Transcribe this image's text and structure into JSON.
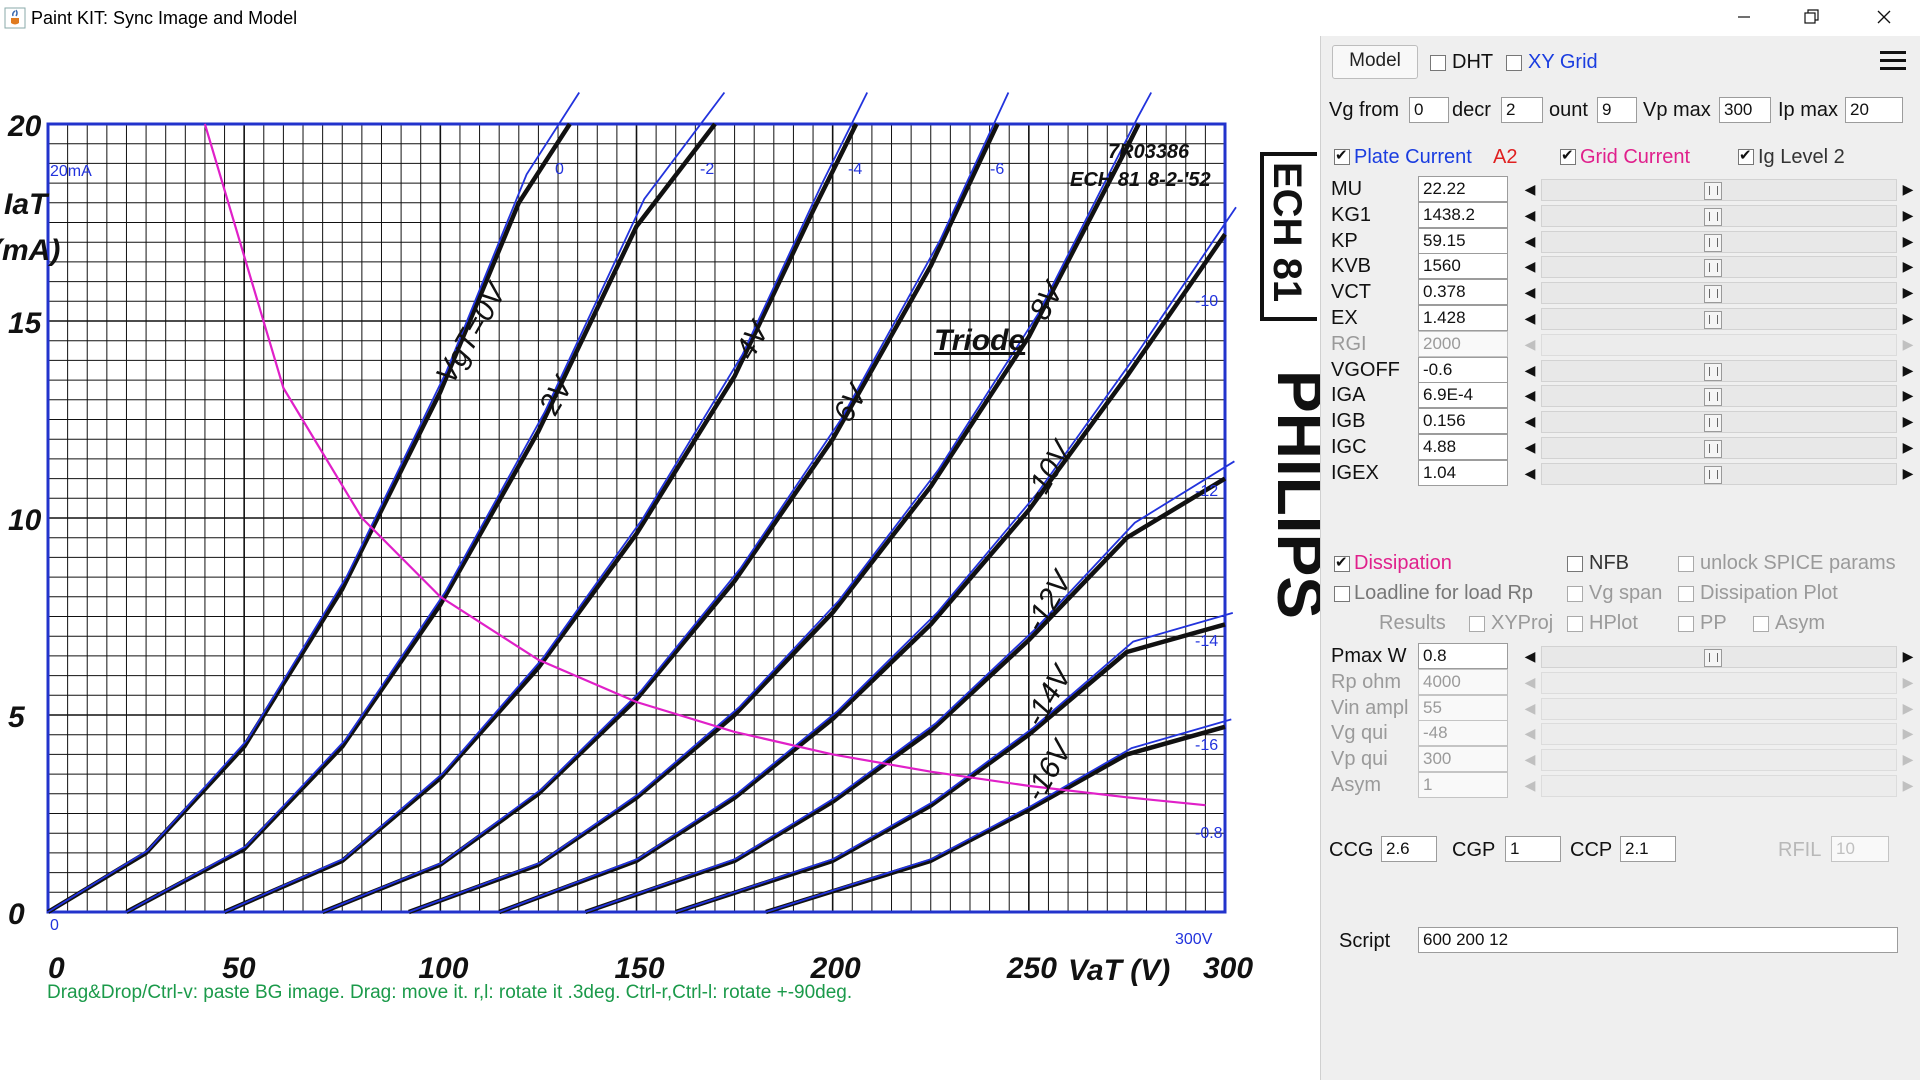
{
  "window": {
    "title": "Paint KIT: Sync Image and Model",
    "minimize_label": "minimize",
    "restore_label": "restore",
    "close_label": "close"
  },
  "canvas": {
    "hint": "Drag&Drop/Ctrl-v: paste BG image. Drag: move it. r,l: rotate it .3deg. Ctrl-r,Ctrl-l: rotate +-90deg.",
    "bg_image": {
      "ref": "7R03386",
      "tube": "ECH 81",
      "date": "8-2-'52",
      "mode": "Triode",
      "brand_box": "ECH 81",
      "brand": "PHILIPS",
      "y_label": "IaT",
      "y_unit": "(mA)",
      "x_label": "VaT (V)",
      "corner_top": "20mA",
      "corner_bottom": "300V",
      "corner_zero": "0"
    }
  },
  "chart_data": {
    "type": "line",
    "title": "",
    "xlabel": "VaT (V)",
    "ylabel": "IaT (mA)",
    "xlim": [
      0,
      300
    ],
    "ylim": [
      0,
      20
    ],
    "x_ticks": [
      "0",
      "50",
      "100",
      "150",
      "200",
      "250",
      "300"
    ],
    "y_ticks": [
      "0",
      "5",
      "10",
      "15",
      "20"
    ],
    "grid": true,
    "model_grid_labels_top": [
      "0",
      "-2",
      "-4",
      "-6"
    ],
    "model_grid_labels_right": [
      "-10",
      "-12",
      "-14",
      "-16",
      "-0.8"
    ],
    "series": [
      {
        "name": "VgT=0V",
        "vg": 0,
        "x": [
          0,
          25,
          50,
          75,
          100,
          120,
          133
        ],
        "y": [
          0,
          1.5,
          4.2,
          8.2,
          13.2,
          18.0,
          20
        ]
      },
      {
        "name": "-2V",
        "vg": -2,
        "x": [
          20,
          50,
          75,
          100,
          125,
          150,
          170
        ],
        "y": [
          0,
          1.6,
          4.2,
          7.8,
          12.2,
          17.4,
          20
        ]
      },
      {
        "name": "-4V",
        "vg": -4,
        "x": [
          45,
          75,
          100,
          125,
          150,
          175,
          195,
          206
        ],
        "y": [
          0,
          1.3,
          3.4,
          6.2,
          9.6,
          13.6,
          17.8,
          20
        ]
      },
      {
        "name": "-6V",
        "vg": -6,
        "x": [
          70,
          100,
          125,
          150,
          175,
          200,
          225,
          242
        ],
        "y": [
          0,
          1.2,
          3.0,
          5.4,
          8.4,
          12.0,
          16.4,
          20
        ]
      },
      {
        "name": "-8V",
        "vg": -8,
        "x": [
          92,
          125,
          150,
          175,
          200,
          225,
          250,
          275,
          278
        ],
        "y": [
          0,
          1.2,
          2.9,
          5.0,
          7.6,
          10.8,
          14.6,
          19.4,
          20
        ]
      },
      {
        "name": "-10V",
        "vg": -10,
        "x": [
          115,
          150,
          175,
          200,
          225,
          250,
          275,
          300
        ],
        "y": [
          0,
          1.3,
          2.9,
          4.9,
          7.3,
          10.2,
          13.6,
          17.2
        ]
      },
      {
        "name": "-12V",
        "vg": -12,
        "x": [
          137,
          175,
          200,
          225,
          250,
          275,
          300
        ],
        "y": [
          0,
          1.3,
          2.8,
          4.6,
          6.9,
          9.5,
          11.0
        ]
      },
      {
        "name": "-14V",
        "vg": -14,
        "x": [
          160,
          200,
          225,
          250,
          275,
          300
        ],
        "y": [
          0,
          1.3,
          2.7,
          4.5,
          6.6,
          7.3
        ]
      },
      {
        "name": "-16V",
        "vg": -16,
        "x": [
          183,
          225,
          250,
          275,
          300
        ],
        "y": [
          0,
          1.3,
          2.6,
          4.0,
          4.7
        ]
      },
      {
        "name": "Dissipation 0.8W",
        "kind": "dissipation",
        "x": [
          40,
          60,
          80,
          100,
          125,
          150,
          175,
          200,
          225,
          250,
          275,
          295
        ],
        "y": [
          20,
          13.3,
          10,
          8,
          6.4,
          5.33,
          4.57,
          4,
          3.56,
          3.2,
          2.91,
          2.71
        ]
      }
    ]
  },
  "panel": {
    "model_button": "Model",
    "dht": {
      "label": "DHT",
      "checked": false
    },
    "xy_grid": {
      "label": "XY Grid",
      "checked": false
    },
    "menu_icon": "hamburger-menu-icon",
    "vg_from": {
      "label": "Vg from",
      "value": "0"
    },
    "decr": {
      "label": "decr",
      "value": "2"
    },
    "count": {
      "label": "ount",
      "value": "9"
    },
    "vp_max": {
      "label": "Vp max",
      "value": "300"
    },
    "ip_max": {
      "label": "Ip max",
      "value": "20"
    },
    "plate_current": {
      "label": "Plate Current",
      "checked": true
    },
    "a2_label": "A2",
    "grid_current": {
      "label": "Grid Current",
      "checked": true
    },
    "ig_level2": {
      "label": "Ig Level 2",
      "checked": true
    },
    "params": [
      {
        "name": "MU",
        "value": "22.22",
        "enabled": true
      },
      {
        "name": "KG1",
        "value": "1438.2",
        "enabled": true
      },
      {
        "name": "KP",
        "value": "59.15",
        "enabled": true
      },
      {
        "name": "KVB",
        "value": "1560",
        "enabled": true
      },
      {
        "name": "VCT",
        "value": "0.378",
        "enabled": true
      },
      {
        "name": "EX",
        "value": "1.428",
        "enabled": true
      },
      {
        "name": "RGI",
        "value": "2000",
        "enabled": false
      },
      {
        "name": "VGOFF",
        "value": "-0.6",
        "enabled": true
      },
      {
        "name": "IGA",
        "value": "6.9E-4",
        "enabled": true
      },
      {
        "name": "IGB",
        "value": "0.156",
        "enabled": true
      },
      {
        "name": "IGC",
        "value": "4.88",
        "enabled": true
      },
      {
        "name": "IGEX",
        "value": "1.04",
        "enabled": true
      }
    ],
    "dissipation": {
      "label": "Dissipation",
      "checked": true
    },
    "nfb": {
      "label": "NFB",
      "checked": false
    },
    "unlock_spice": {
      "label": "unlock SPICE params",
      "checked": false
    },
    "loadline": {
      "label": "Loadline for load Rp",
      "checked": false
    },
    "vg_span": {
      "label": "Vg span",
      "checked": false
    },
    "dissipation_plot": {
      "label": "Dissipation Plot",
      "checked": false
    },
    "results_label": "Results",
    "xyproj": {
      "label": "XYProj",
      "checked": false
    },
    "hplot": {
      "label": "HPlot",
      "checked": false
    },
    "pp": {
      "label": "PP",
      "checked": false
    },
    "asym_cb": {
      "label": "Asym",
      "checked": false
    },
    "params2": [
      {
        "name": "Pmax W",
        "value": "0.8",
        "enabled": true
      },
      {
        "name": "Rp ohm",
        "value": "4000",
        "enabled": false
      },
      {
        "name": "Vin ampl",
        "value": "55",
        "enabled": false
      },
      {
        "name": "Vg qui",
        "value": "-48",
        "enabled": false
      },
      {
        "name": "Vp qui",
        "value": "300",
        "enabled": false
      },
      {
        "name": "Asym",
        "value": "1",
        "enabled": false
      }
    ],
    "ccg": {
      "label": "CCG",
      "value": "2.6"
    },
    "cgp": {
      "label": "CGP",
      "value": "1"
    },
    "ccp": {
      "label": "CCP",
      "value": "2.1"
    },
    "rfil": {
      "label": "RFIL",
      "value": "10"
    },
    "script": {
      "label": "Script",
      "value": "600 200 12"
    }
  }
}
